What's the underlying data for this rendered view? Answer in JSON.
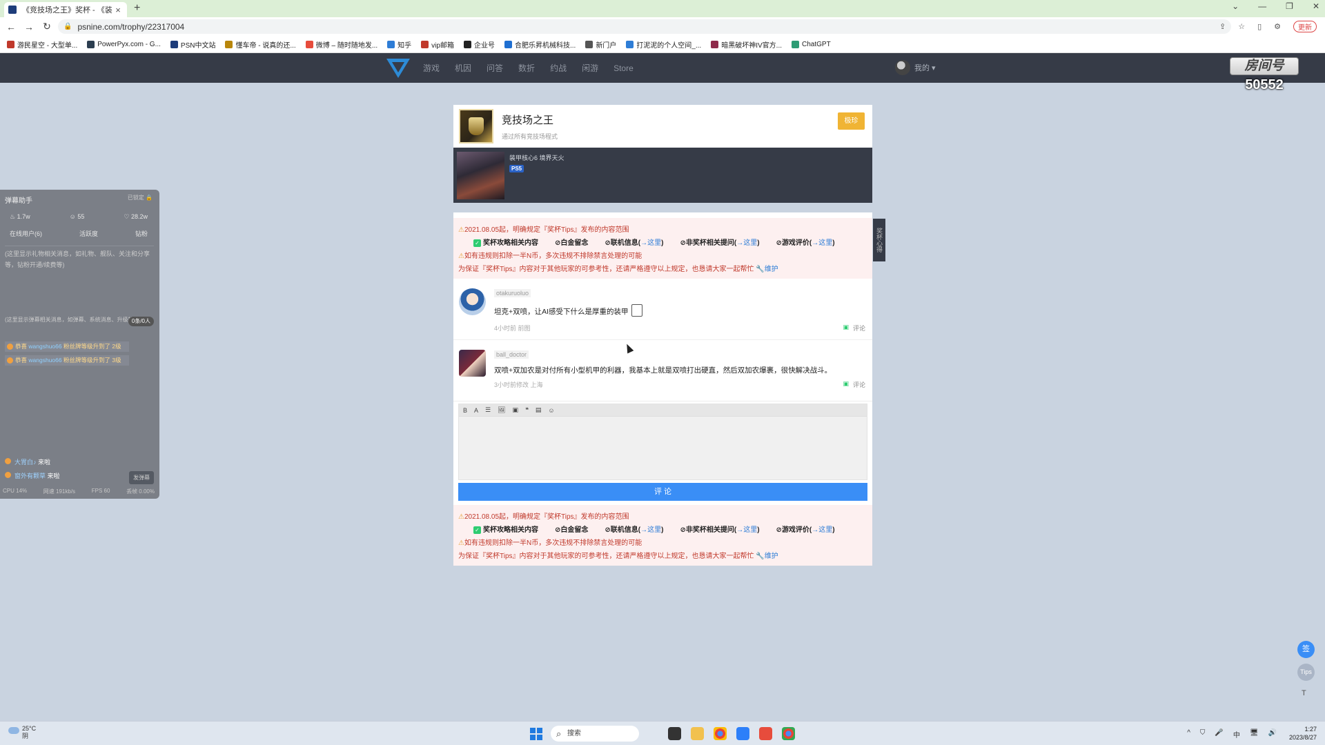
{
  "browser": {
    "tab_title": "《竞技场之王》奖杯 - 《装甲核...",
    "new_tab": "+",
    "url": "psnine.com/trophy/22317004",
    "update_label": "更新",
    "bookmarks": [
      "游民星空 - 大型单...",
      "PowerPyx.com - G...",
      "PSN中文站",
      "懂车帝 - 说真的还...",
      "微博 – 随时随地发...",
      "知乎",
      "vip邮箱",
      "企业号",
      "合肥乐昇机械科技...",
      "新门户",
      "打泥泥的个人空间_...",
      "暗黑破坏神IV官方...",
      "ChatGPT"
    ]
  },
  "site": {
    "nav": [
      "游戏",
      "机因",
      "问答",
      "数折",
      "约战",
      "闲游",
      "Store"
    ],
    "user_menu": "我的 ▾",
    "room_label": "房间号",
    "room_number": "50552"
  },
  "trophy": {
    "name": "竞技场之王",
    "description": "通过所有竞技场程式",
    "rarity": "极珍",
    "game_title": "装甲核心6 境界天火",
    "platform": "PS5"
  },
  "side_tab": "奖杯心得",
  "notice": {
    "date_line": "2021.08.05起，明确规定『奖杯Tips』发布的内容范围",
    "allowed": "奖杯攻略相关内容",
    "banned": [
      {
        "label": "白金留念",
        "link": ""
      },
      {
        "label": "联机信息(",
        "link": "→这里",
        "close": ")"
      },
      {
        "label": "非奖杯相关提问(",
        "link": "→这里",
        "close": ")"
      },
      {
        "label": "游戏评价(",
        "link": "→这里",
        "close": ")"
      }
    ],
    "penalty": "如有违规则扣除一半N币，多次违规不排除禁言处理的可能",
    "footer": "为保证『奖杯Tips』内容对于其他玩家的可参考性，还请严格遵守以上规定，也恳请大家一起帮忙",
    "footer_link": "维护"
  },
  "comments": [
    {
      "user": "otakuruoluo",
      "text": "坦克+双喷，让AI感受下什么是厚重的装甲",
      "meta": "4小时前 前图",
      "reply": "评论"
    },
    {
      "user": "ball_doctor",
      "text": "双喷+双加农是对付所有小型机甲的利器，我基本上就是双喷打出硬直，然后双加农爆裹，很快解决战斗。",
      "meta": "3小时前修改 上海",
      "reply": "评论"
    }
  ],
  "editor": {
    "tools": [
      "B",
      "A",
      "☰",
      "🖼",
      "▣",
      "❝",
      "▤",
      "☺"
    ],
    "submit": "评 论"
  },
  "danmu": {
    "title": "弹幕助手",
    "locked": "已锁定",
    "stats": [
      "1.7w",
      "55",
      "28.2w"
    ],
    "tabs": [
      "在线用户(6)",
      "活跃度",
      "钻粉"
    ],
    "area1_text": "(这里显示礼物相关消息，如礼物、舰队、关注和分享等，钻粉开通/续费等)",
    "area2_text": "(这里显示弹幕相关消息，如弹幕、系统消息、升级等)",
    "area2_badge": "0条/0人",
    "messages": [
      {
        "prefix": "恭喜",
        "user": "wangshuo66",
        "text": "粉丝牌等级升到了 2级"
      },
      {
        "prefix": "恭喜",
        "user": "wangshuo66",
        "text": "粉丝牌等级升到了 3级"
      }
    ],
    "visits": [
      {
        "user": "大胃白♪",
        "action": "来啦"
      },
      {
        "user": "窗外有颗草",
        "action": "来啦"
      }
    ],
    "send": "发弹幕",
    "status": [
      "CPU 14%",
      "网速 191kb/s",
      "FPS 60",
      "丢帧 0.00%"
    ]
  },
  "fab": {
    "top_label": "签",
    "tips_label": "Tips",
    "back_label": "T"
  },
  "taskbar": {
    "temp": "25°C",
    "weather": "阴",
    "search": "搜索",
    "tray": [
      "^",
      "中"
    ],
    "time": "1:27",
    "date": "2023/8/27"
  }
}
